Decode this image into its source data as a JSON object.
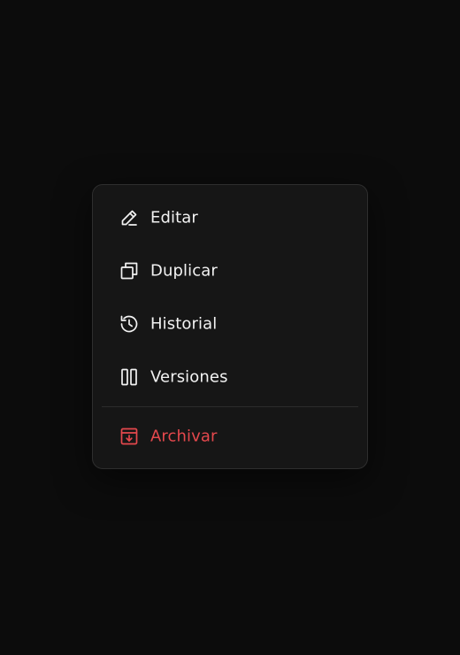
{
  "menu": {
    "items": [
      {
        "label": "Editar",
        "icon": "pencil-icon"
      },
      {
        "label": "Duplicar",
        "icon": "copy-icon"
      },
      {
        "label": "Historial",
        "icon": "history-icon"
      },
      {
        "label": "Versiones",
        "icon": "columns-icon"
      },
      {
        "label": "Archivar",
        "icon": "archive-icon",
        "variant": "danger"
      }
    ]
  },
  "colors": {
    "background": "#0c0c0c",
    "menu_background": "#161616",
    "text": "#f2f2f2",
    "danger": "#e5484d"
  }
}
